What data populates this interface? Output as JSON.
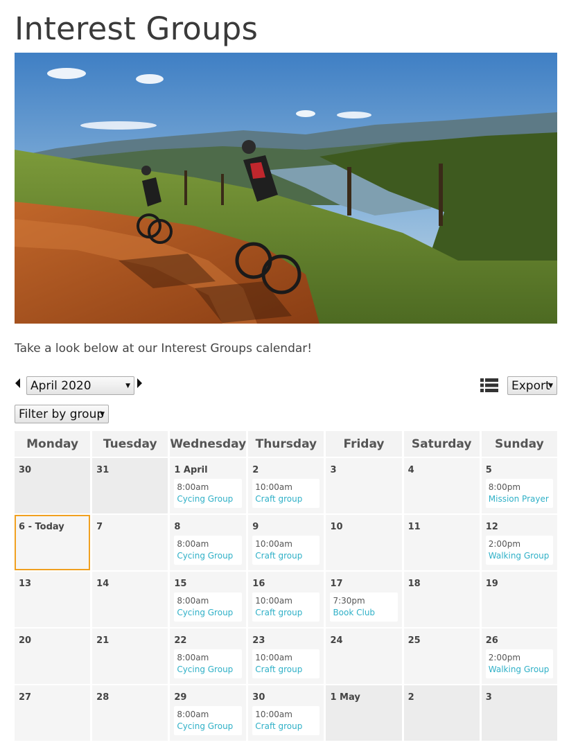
{
  "page": {
    "title": "Interest Groups",
    "intro": "Take a look below at our Interest Groups calendar!"
  },
  "hero": {
    "description_icon": "photo-cyclists-landscape"
  },
  "toolbar": {
    "month_label": "April 2020",
    "filter_label": "Filter by group",
    "export_label": "Export",
    "list_view_icon": "list-icon",
    "prev_icon": "triangle-left-icon",
    "next_icon": "triangle-right-icon"
  },
  "colors": {
    "accent": "#2fb0c7",
    "today_border": "#f0a020",
    "header_bg": "#f3f3f3"
  },
  "calendar": {
    "weekdays": [
      "Monday",
      "Tuesday",
      "Wednesday",
      "Thursday",
      "Friday",
      "Saturday",
      "Sunday"
    ],
    "weeks": [
      [
        {
          "day": "30",
          "other": true
        },
        {
          "day": "31",
          "other": true
        },
        {
          "day": "1 April",
          "events": [
            {
              "time": "8:00am",
              "title": "Cycing Group"
            }
          ]
        },
        {
          "day": "2",
          "events": [
            {
              "time": "10:00am",
              "title": "Craft group"
            }
          ]
        },
        {
          "day": "3"
        },
        {
          "day": "4"
        },
        {
          "day": "5",
          "events": [
            {
              "time": "8:00pm",
              "title": "Mission Prayer"
            }
          ]
        }
      ],
      [
        {
          "day": "6 - Today",
          "today": true
        },
        {
          "day": "7"
        },
        {
          "day": "8",
          "events": [
            {
              "time": "8:00am",
              "title": "Cycing Group"
            }
          ]
        },
        {
          "day": "9",
          "events": [
            {
              "time": "10:00am",
              "title": "Craft group"
            }
          ]
        },
        {
          "day": "10"
        },
        {
          "day": "11"
        },
        {
          "day": "12",
          "events": [
            {
              "time": "2:00pm",
              "title": "Walking Group"
            }
          ]
        }
      ],
      [
        {
          "day": "13"
        },
        {
          "day": "14"
        },
        {
          "day": "15",
          "events": [
            {
              "time": "8:00am",
              "title": "Cycing Group"
            }
          ]
        },
        {
          "day": "16",
          "events": [
            {
              "time": "10:00am",
              "title": "Craft group"
            }
          ]
        },
        {
          "day": "17",
          "events": [
            {
              "time": "7:30pm",
              "title": "Book Club"
            }
          ]
        },
        {
          "day": "18"
        },
        {
          "day": "19"
        }
      ],
      [
        {
          "day": "20"
        },
        {
          "day": "21"
        },
        {
          "day": "22",
          "events": [
            {
              "time": "8:00am",
              "title": "Cycing Group"
            }
          ]
        },
        {
          "day": "23",
          "events": [
            {
              "time": "10:00am",
              "title": "Craft group"
            }
          ]
        },
        {
          "day": "24"
        },
        {
          "day": "25"
        },
        {
          "day": "26",
          "events": [
            {
              "time": "2:00pm",
              "title": "Walking Group"
            }
          ]
        }
      ],
      [
        {
          "day": "27"
        },
        {
          "day": "28"
        },
        {
          "day": "29",
          "events": [
            {
              "time": "8:00am",
              "title": "Cycing Group"
            }
          ]
        },
        {
          "day": "30",
          "events": [
            {
              "time": "10:00am",
              "title": "Craft group"
            }
          ]
        },
        {
          "day": "1 May",
          "other": true
        },
        {
          "day": "2",
          "other": true
        },
        {
          "day": "3",
          "other": true
        }
      ]
    ]
  }
}
